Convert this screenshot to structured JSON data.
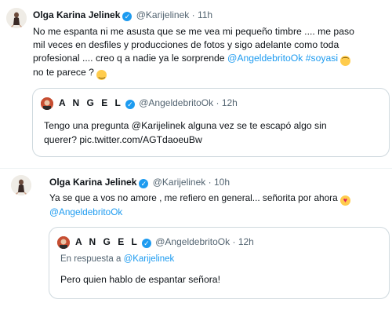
{
  "tweet1": {
    "name": "Olga Karina Jelinek",
    "handle": "@Karijelinek",
    "sep": "·",
    "time": "11h",
    "lines": [
      "No me espanta ni me asusta que se me vea mi pequeño timbre .... me paso",
      "mil veces en desfiles y producciones de fotos y sigo adelante como toda"
    ],
    "line3_prefix": "profesional .... creo q a nadie ya le sorprende ",
    "mention": "@AngeldebritoOk",
    "hashtag": "#soyasi",
    "line4": "no te parece ?",
    "emoji_a": "upside-down-face",
    "emoji_b": "slightly-smiling-face",
    "quote": {
      "name": "A N G E L",
      "handle": "@AngeldebritoOk",
      "sep": "·",
      "time": "12h",
      "lines": [
        "Tengo una pregunta @Karijelinek alguna vez se te escapó algo sin",
        "querer? pic.twitter.com/AGTdaoeuBw"
      ]
    }
  },
  "tweet2": {
    "name": "Olga Karina Jelinek",
    "handle": "@Karijelinek",
    "sep": "·",
    "time": "10h",
    "line1": "Ya se que a vos no amore , me refiero en general... señorita por ahora",
    "emoji": "heart-eyes",
    "mention": "@AngeldebritoOk",
    "quote": {
      "name": "A N G E L",
      "handle": "@AngeldebritoOk",
      "sep": "·",
      "time": "12h",
      "reply_prefix": "En respuesta a",
      "reply_handle": "@Karijelinek",
      "text": "Pero quien hablo de espantar señora!"
    }
  },
  "colors": {
    "accent": "#1d9bf0",
    "text": "#0f1419",
    "muted": "#536471"
  }
}
